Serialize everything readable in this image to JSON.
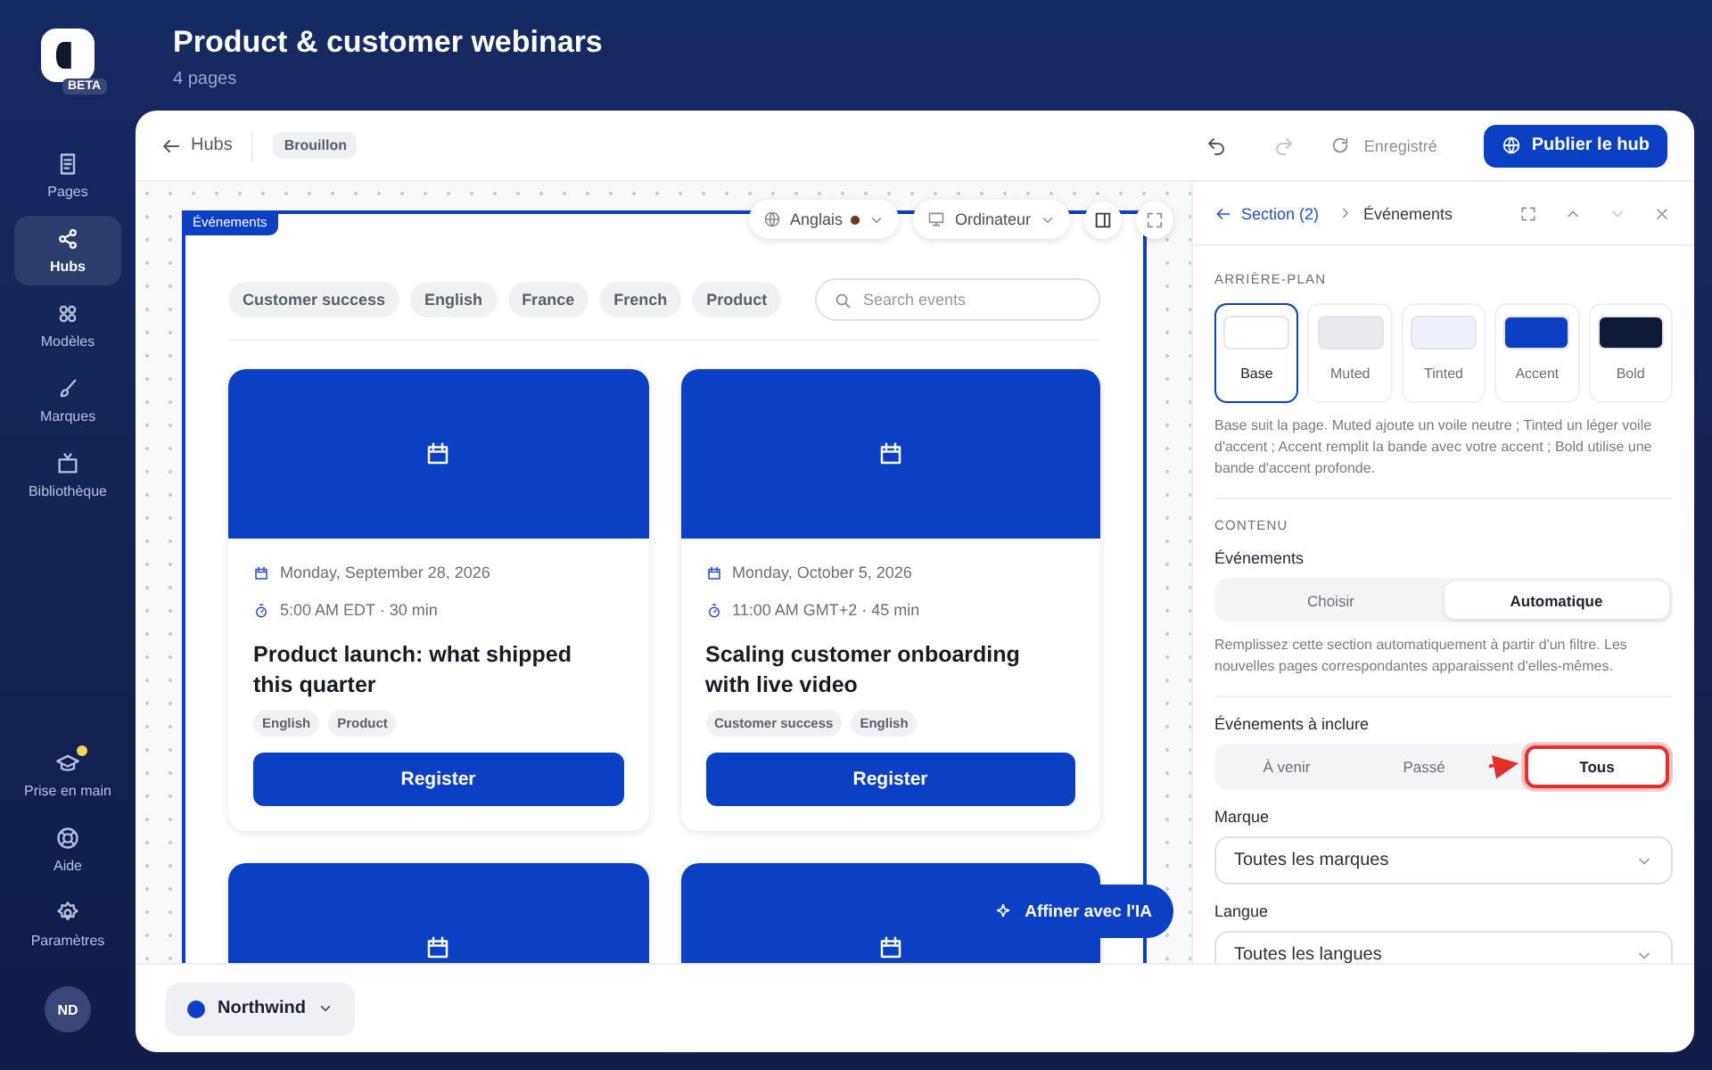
{
  "app": {
    "badge": "BETA"
  },
  "header": {
    "title": "Product & customer webinars",
    "subtitle": "4 pages"
  },
  "sidebar": {
    "items": [
      {
        "label": "Pages",
        "selected": false
      },
      {
        "label": "Hubs",
        "selected": true
      },
      {
        "label": "Modèles",
        "selected": false
      },
      {
        "label": "Marques",
        "selected": false
      },
      {
        "label": "Bibliothèque",
        "selected": false
      }
    ],
    "bottom_items": [
      {
        "label": "Prise en main",
        "notification": true
      },
      {
        "label": "Aide",
        "notification": false
      },
      {
        "label": "Paramètres",
        "notification": false
      }
    ],
    "avatar": "ND"
  },
  "toolbar": {
    "back": "Hubs",
    "status": "Brouillon",
    "undo": {
      "disabled": false
    },
    "redo": {
      "disabled": true
    },
    "saved": "Enregistré",
    "publish": "Publier le hub"
  },
  "canvas": {
    "section_tag": "Événements",
    "language": {
      "label": "Anglais",
      "unsaved": true
    },
    "device": "Ordinateur",
    "filters": [
      "Customer success",
      "English",
      "France",
      "French",
      "Product"
    ],
    "search": {
      "placeholder": "Search events"
    },
    "events": [
      {
        "kind": "full",
        "date": "Monday, September 28, 2026",
        "time": "5:00 AM EDT · 30 min",
        "title": "Product launch: what shipped this quarter",
        "tags": [
          "English",
          "Product"
        ],
        "button": "Register"
      },
      {
        "kind": "full",
        "date": "Monday, October 5, 2026",
        "time": "11:00 AM GMT+2 · 45 min",
        "title": "Scaling customer onboarding with live video",
        "tags": [
          "Customer success",
          "English"
        ],
        "button": "Register"
      },
      {
        "kind": "cropped"
      },
      {
        "kind": "cropped"
      }
    ],
    "ai_button": "Affiner avec l'IA"
  },
  "brand_switcher": {
    "label": "Northwind"
  },
  "inspector": {
    "back": "Section (2)",
    "current": "Événements",
    "background": {
      "label": "ARRIÈRE-PLAN",
      "options": [
        {
          "label": "Base",
          "color": "#ffffff",
          "selected": true
        },
        {
          "label": "Muted",
          "color": "#e8eaee",
          "selected": false
        },
        {
          "label": "Tinted",
          "color": "#eef1fb",
          "selected": false
        },
        {
          "label": "Accent",
          "color": "#0b3fc4",
          "selected": false
        },
        {
          "label": "Bold",
          "color": "#0e1a33",
          "selected": false
        }
      ],
      "help": "Base suit la page. Muted ajoute un voile neutre ; Tinted un léger voile d'accent ; Accent remplit la bande avec votre accent ; Bold utilise une bande d'accent profonde."
    },
    "content_label": "CONTENU",
    "events_source": {
      "label": "Événements",
      "options": [
        {
          "label": "Choisir",
          "selected": false
        },
        {
          "label": "Automatique",
          "selected": true
        }
      ],
      "help": "Remplissez cette section automatiquement à partir d'un filtre. Les nouvelles pages correspondantes apparaissent d'elles-mêmes."
    },
    "include": {
      "label": "Événements à inclure",
      "options": [
        {
          "label": "À venir",
          "selected": false,
          "highlighted": false
        },
        {
          "label": "Passé",
          "selected": false,
          "highlighted": false
        },
        {
          "label": "Tous",
          "selected": true,
          "highlighted": true
        }
      ]
    },
    "brand": {
      "label": "Marque",
      "value": "Toutes les marques"
    },
    "language": {
      "label": "Langue",
      "value": "Toutes les langues"
    }
  }
}
